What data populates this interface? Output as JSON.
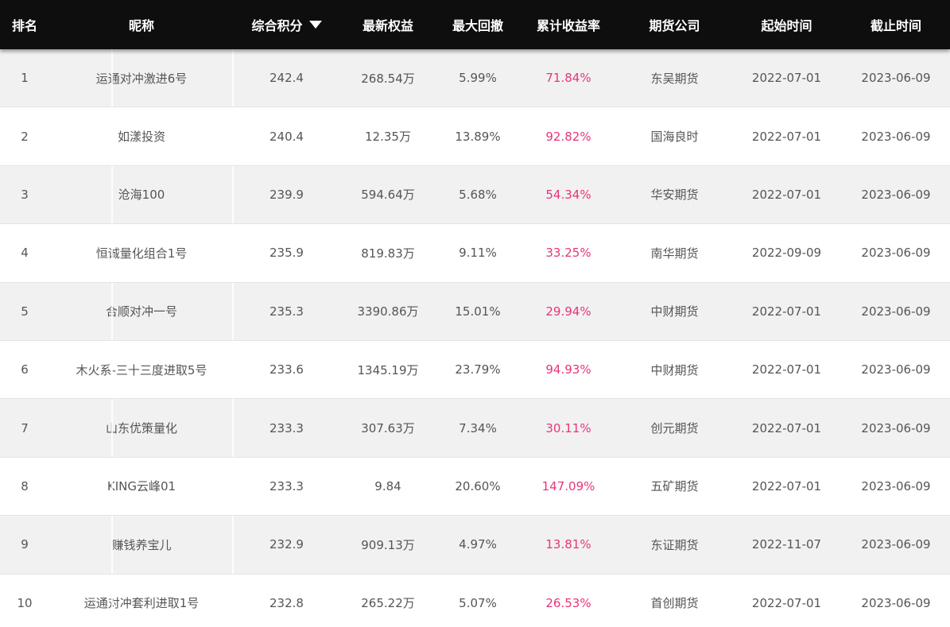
{
  "colors": {
    "header_bg": "#0e0e0e",
    "header_text": "#ffffff",
    "row_alt_bg": "#f1f1f1",
    "row_bg": "#ffffff",
    "text": "#555555",
    "rate_text": "#e8347a"
  },
  "header": {
    "rank": "排名",
    "nickname": "昵称",
    "score": "综合积分",
    "score_sort_icon": "sort-desc-triangle",
    "equity": "最新权益",
    "max_drawdown": "最大回撤",
    "cumulative_return": "累计收益率",
    "futures_company": "期货公司",
    "start_date": "起始时间",
    "end_date": "截止时间"
  },
  "rows": [
    {
      "rank": "1",
      "nickname": "运通对冲激进6号",
      "score": "242.4",
      "equity": "268.54万",
      "max_drawdown": "5.99%",
      "cumulative_return": "71.84%",
      "futures_company": "东吴期货",
      "start_date": "2022-07-01",
      "end_date": "2023-06-09"
    },
    {
      "rank": "2",
      "nickname": "如漾投资",
      "score": "240.4",
      "equity": "12.35万",
      "max_drawdown": "13.89%",
      "cumulative_return": "92.82%",
      "futures_company": "国海良时",
      "start_date": "2022-07-01",
      "end_date": "2023-06-09"
    },
    {
      "rank": "3",
      "nickname": "沧海100",
      "score": "239.9",
      "equity": "594.64万",
      "max_drawdown": "5.68%",
      "cumulative_return": "54.34%",
      "futures_company": "华安期货",
      "start_date": "2022-07-01",
      "end_date": "2023-06-09"
    },
    {
      "rank": "4",
      "nickname": "恒诚量化组合1号",
      "score": "235.9",
      "equity": "819.83万",
      "max_drawdown": "9.11%",
      "cumulative_return": "33.25%",
      "futures_company": "南华期货",
      "start_date": "2022-09-09",
      "end_date": "2023-06-09"
    },
    {
      "rank": "5",
      "nickname": "合顺对冲一号",
      "score": "235.3",
      "equity": "3390.86万",
      "max_drawdown": "15.01%",
      "cumulative_return": "29.94%",
      "futures_company": "中财期货",
      "start_date": "2022-07-01",
      "end_date": "2023-06-09"
    },
    {
      "rank": "6",
      "nickname": "木火系-三十三度进取5号",
      "score": "233.6",
      "equity": "1345.19万",
      "max_drawdown": "23.79%",
      "cumulative_return": "94.93%",
      "futures_company": "中财期货",
      "start_date": "2022-07-01",
      "end_date": "2023-06-09"
    },
    {
      "rank": "7",
      "nickname": "山东优策量化",
      "score": "233.3",
      "equity": "307.63万",
      "max_drawdown": "7.34%",
      "cumulative_return": "30.11%",
      "futures_company": "创元期货",
      "start_date": "2022-07-01",
      "end_date": "2023-06-09"
    },
    {
      "rank": "8",
      "nickname": "KING云峰01",
      "score": "233.3",
      "equity": "9.84",
      "max_drawdown": "20.60%",
      "cumulative_return": "147.09%",
      "futures_company": "五矿期货",
      "start_date": "2022-07-01",
      "end_date": "2023-06-09"
    },
    {
      "rank": "9",
      "nickname": "赚钱养宝儿",
      "score": "232.9",
      "equity": "909.13万",
      "max_drawdown": "4.97%",
      "cumulative_return": "13.81%",
      "futures_company": "东证期货",
      "start_date": "2022-11-07",
      "end_date": "2023-06-09"
    },
    {
      "rank": "10",
      "nickname": "运通对冲套利进取1号",
      "score": "232.8",
      "equity": "265.22万",
      "max_drawdown": "5.07%",
      "cumulative_return": "26.53%",
      "futures_company": "首创期货",
      "start_date": "2022-07-01",
      "end_date": "2023-06-09"
    }
  ]
}
